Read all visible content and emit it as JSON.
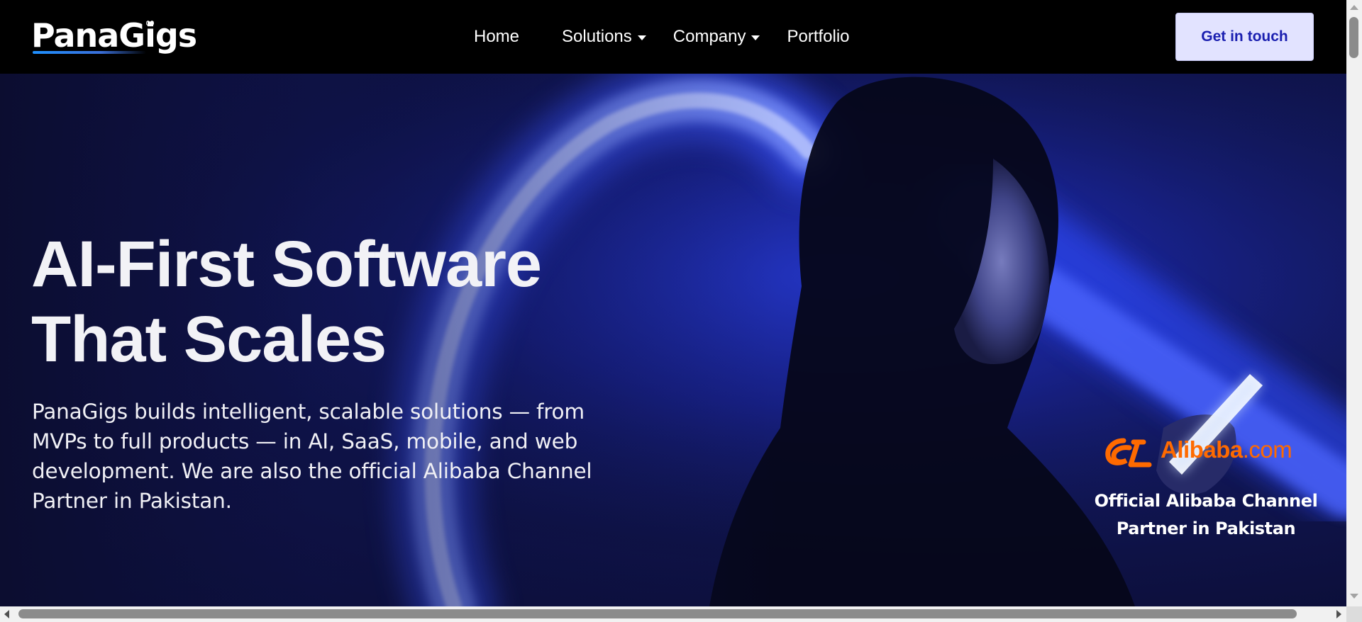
{
  "brand": {
    "name": "PanaGigs",
    "logo_icon": "infinity-icon"
  },
  "nav": {
    "items": [
      {
        "label": "Home",
        "has_dropdown": false
      },
      {
        "label": "Solutions",
        "has_dropdown": true
      },
      {
        "label": "Company",
        "has_dropdown": true
      },
      {
        "label": "Portfolio",
        "has_dropdown": false
      }
    ],
    "cta_label": "Get in touch"
  },
  "hero": {
    "title_line1": "AI-First Software",
    "title_line2": "That Scales",
    "description": "PanaGigs builds intelligent, scalable solutions — from MVPs to full products — in AI, SaaS, mobile, and web development. We are also the official Alibaba Channel Partner in Pakistan.",
    "partner": {
      "logo_name": "Alibaba",
      "logo_suffix": ".com",
      "caption_line1": "Official Alibaba Channel",
      "caption_line2": "Partner in Pakistan"
    }
  },
  "colors": {
    "navbar_bg": "#000000",
    "cta_bg": "#e2e3ff",
    "cta_text": "#1a1fb0",
    "hero_bg": "#151d6d",
    "light_streak": "#4f6cff",
    "alibaba_orange": "#ff6a00",
    "text_light": "#f2f2f6"
  }
}
